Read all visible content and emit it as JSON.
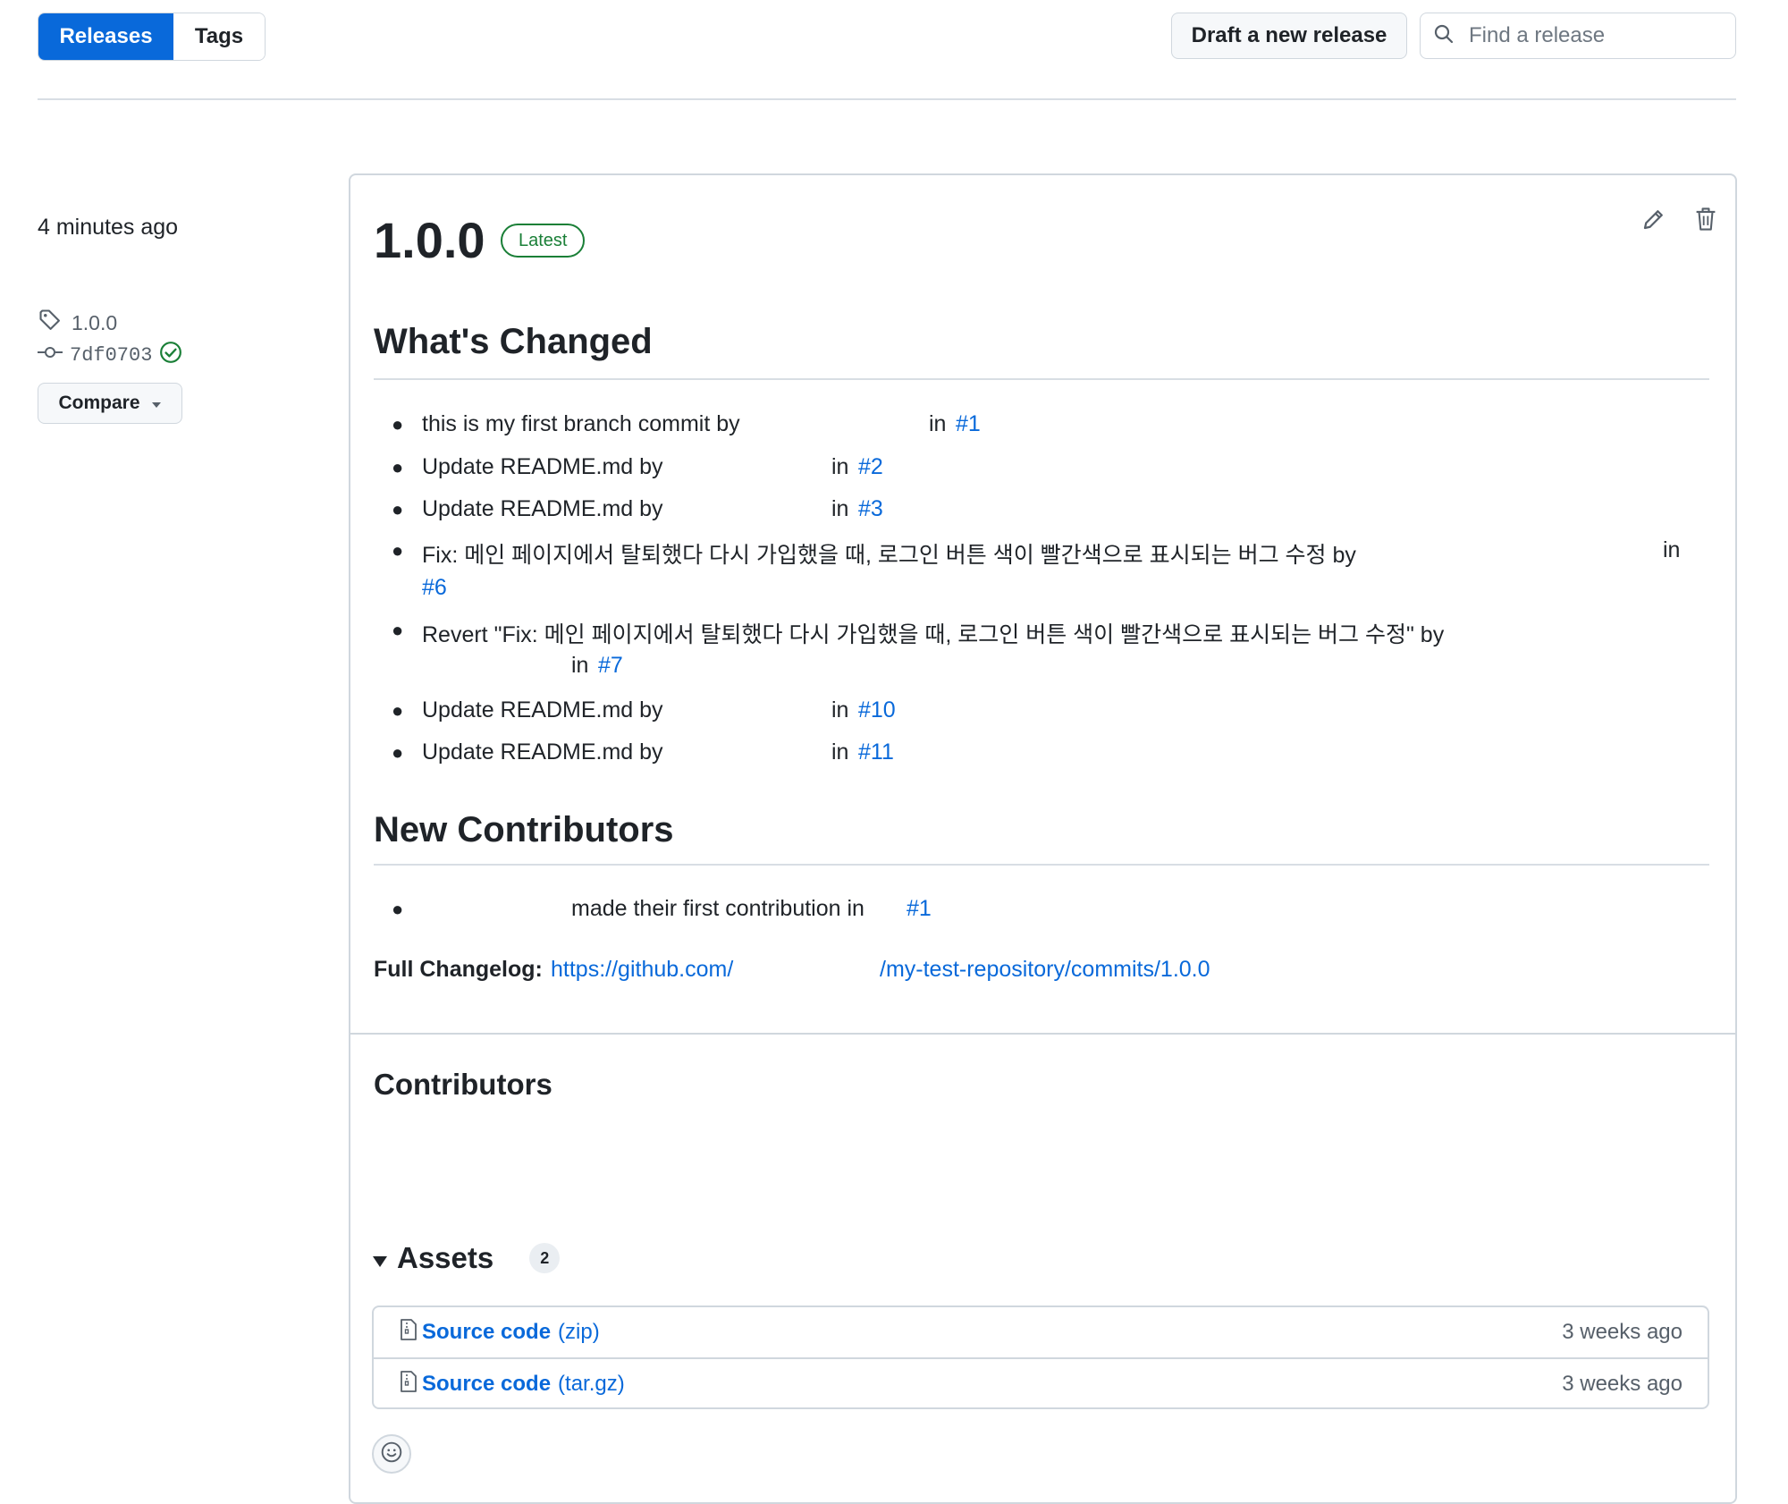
{
  "tabs": {
    "releases": "Releases",
    "tags": "Tags"
  },
  "actions": {
    "draft": "Draft a new release",
    "search_placeholder": "Find a release"
  },
  "meta": {
    "time": "4 minutes ago",
    "tag": "1.0.0",
    "commit": "7df0703",
    "compare": "Compare"
  },
  "release": {
    "version": "1.0.0",
    "badge": "Latest",
    "whats_changed": "What's Changed",
    "changes": [
      {
        "text": "this is my first branch commit by",
        "in": "in",
        "pr": "#1"
      },
      {
        "text": "Update README.md by",
        "in": "in",
        "pr": "#2"
      },
      {
        "text": "Update README.md by",
        "in": "in",
        "pr": "#3"
      },
      {
        "text": "Fix: 메인 페이지에서 탈퇴했다 다시 가입했을 때, 로그인 버튼 색이 빨간색으로 표시되는 버그 수정 by",
        "in": "in",
        "pr": "#6"
      },
      {
        "text": "Revert \"Fix: 메인 페이지에서 탈퇴했다 다시 가입했을 때, 로그인 버튼 색이 빨간색으로 표시되는 버그 수정\" by",
        "in": "in",
        "pr": "#7"
      },
      {
        "text": "Update README.md by",
        "in": "in",
        "pr": "#10"
      },
      {
        "text": "Update README.md by",
        "in": "in",
        "pr": "#11"
      }
    ],
    "new_contributors": "New Contributors",
    "new_contrib_text": "made their first contribution in",
    "new_contrib_pr": "#1",
    "full_changelog_label": "Full Changelog:",
    "changelog_link_a": "https://github.com/",
    "changelog_link_b": "/my-test-repository/commits/1.0.0",
    "contributors": "Contributors",
    "assets_label": "Assets",
    "assets_count": "2",
    "assets": [
      {
        "name": "Source code",
        "ext": "(zip)",
        "when": "3 weeks ago"
      },
      {
        "name": "Source code",
        "ext": "(tar.gz)",
        "when": "3 weeks ago"
      }
    ]
  },
  "colors": {
    "accent": "#0969da",
    "success": "#1a7f37",
    "border": "#d0d7de",
    "muted": "#57606a"
  }
}
